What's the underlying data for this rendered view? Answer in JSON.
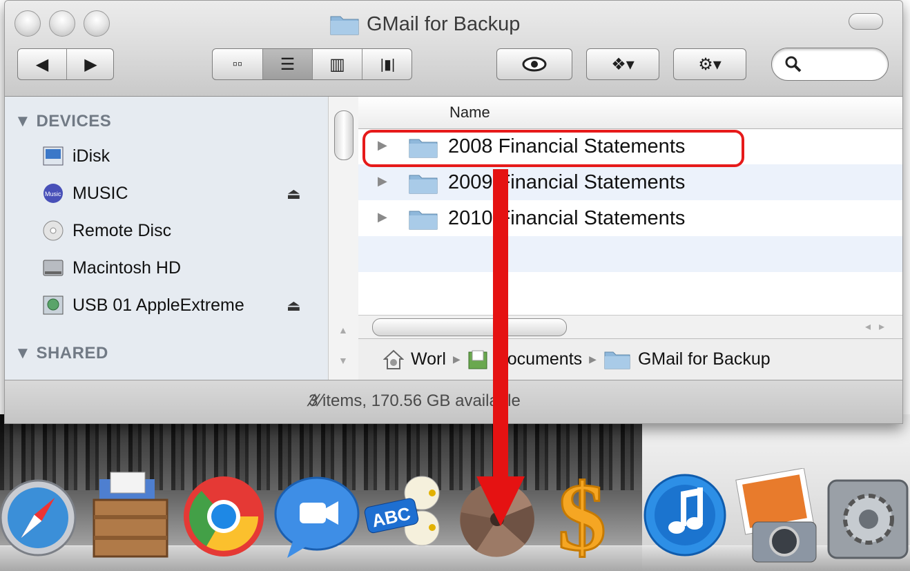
{
  "window": {
    "title": "GMail for Backup",
    "status": "3 items, 170.56 GB available"
  },
  "toolbar": {
    "back_icon": "back-arrow-icon",
    "forward_icon": "forward-arrow-icon",
    "views": [
      "icon-view",
      "list-view",
      "column-view",
      "coverflow-view"
    ],
    "active_view": "list-view",
    "search_placeholder": ""
  },
  "sidebar": {
    "devices_header": "DEVICES",
    "shared_header": "SHARED",
    "devices": [
      {
        "label": "iDisk",
        "icon": "idisk-icon",
        "eject": false
      },
      {
        "label": "MUSIC",
        "icon": "music-disk-icon",
        "eject": true
      },
      {
        "label": "Remote Disc",
        "icon": "cd-icon",
        "eject": false
      },
      {
        "label": "Macintosh HD",
        "icon": "hard-drive-icon",
        "eject": false
      },
      {
        "label": "USB 01 AppleExtreme",
        "icon": "timemachine-drive-icon",
        "eject": true
      }
    ],
    "eject_glyph": "⏏"
  },
  "list": {
    "column_name": "Name",
    "rows": [
      {
        "name": "2008 Financial Statements"
      },
      {
        "name": "2009 Financial Statements"
      },
      {
        "name": "2010 Financial Statements"
      }
    ]
  },
  "path": {
    "items": [
      "Worl",
      "Documents",
      "GMail for Backup"
    ]
  },
  "colors": {
    "annotation_red": "#e51212",
    "folder_blue": "#8fb8db",
    "sidebar_bg": "#e6ebf1"
  },
  "dock": {
    "icons": [
      "safari-icon",
      "stuffit-expander-icon",
      "chrome-icon",
      "ichat-icon",
      "spell-check-icon",
      "dropzone-icon",
      "dollar-icon",
      "itunes-icon",
      "iphoto-icon",
      "system-preferences-icon"
    ]
  }
}
